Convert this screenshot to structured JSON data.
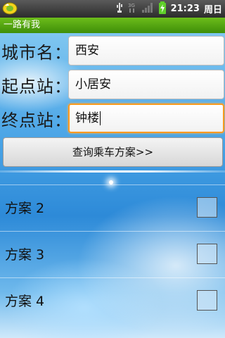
{
  "status_bar": {
    "time": "21:23",
    "day": "周日",
    "icons": [
      "app-icon",
      "usb-icon",
      "3g-icon",
      "signal-icon",
      "battery-charging-icon"
    ]
  },
  "app": {
    "title": "一路有我"
  },
  "form": {
    "city_label": "城市名：",
    "city_value": "西安",
    "start_label": "起点站：",
    "start_value": "小居安",
    "end_label": "终点站：",
    "end_value": "钟楼"
  },
  "query_button": "查询乘车方案>>",
  "plans": [
    {
      "label": "方案 2",
      "checked": false
    },
    {
      "label": "方案 3",
      "checked": false
    },
    {
      "label": "方案 4",
      "checked": false
    }
  ],
  "colors": {
    "title_bar": "#4fa010",
    "focus_border": "#ff9a1e",
    "status_bar": "#3a3a3a"
  }
}
